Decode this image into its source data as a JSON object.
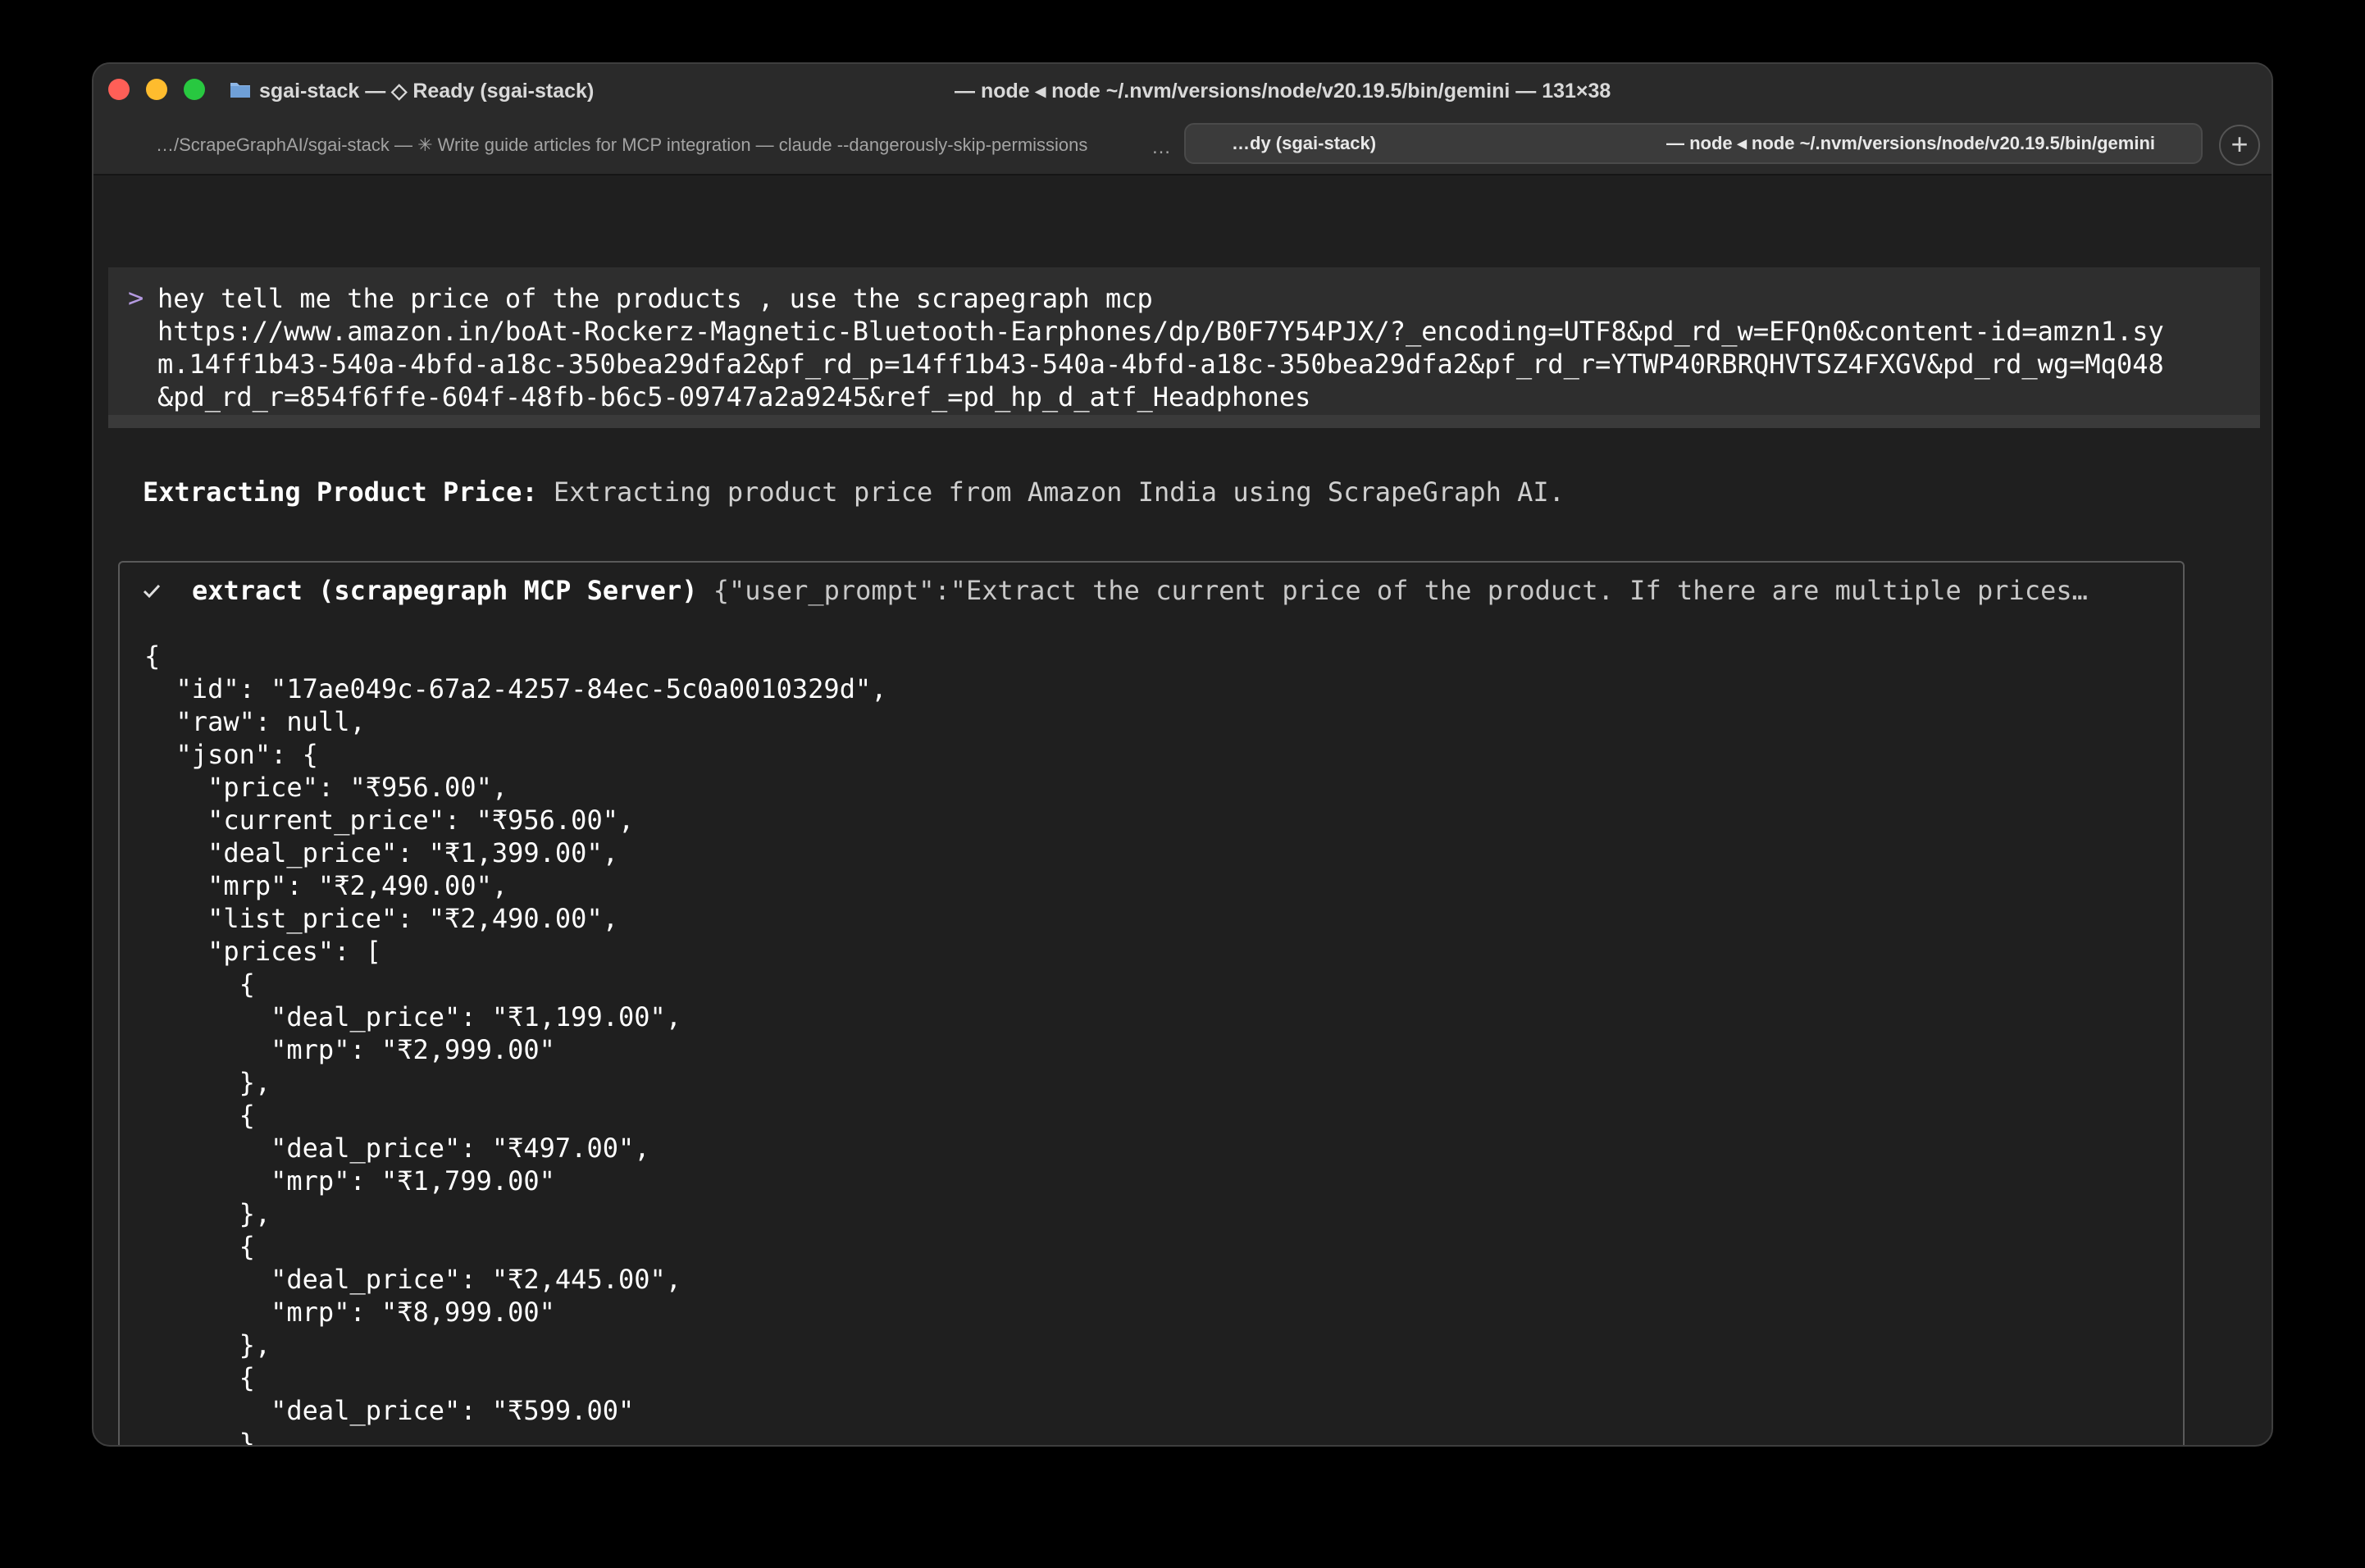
{
  "titlebar": {
    "left_title": "sgai-stack — ◇ Ready (sgai-stack)",
    "center_title": "— node ◂ node ~/.nvm/versions/node/v20.19.5/bin/gemini — 131×38"
  },
  "tabs": {
    "tab1_label": "…/ScrapeGraphAI/sgai-stack — ✳ Write guide articles for MCP integration — claude --dangerously-skip-permissions",
    "overflow_label": "…",
    "tab2_left": "…dy (sgai-stack)",
    "tab2_right": "— node ◂ node ~/.nvm/versions/node/v20.19.5/bin/gemini",
    "new_tab_label": "+"
  },
  "prompt": {
    "chevron": ">",
    "text": "hey tell me the price of the products , use the scrapegraph mcp\nhttps://www.amazon.in/boAt-Rockerz-Magnetic-Bluetooth-Earphones/dp/B0F7Y54PJX/?_encoding=UTF8&pd_rd_w=EFQn0&content-id=amzn1.sy\nm.14ff1b43-540a-4bfd-a18c-350bea29dfa2&pf_rd_p=14ff1b43-540a-4bfd-a18c-350bea29dfa2&pf_rd_r=YTWP40RBRQHVTSZ4FXGV&pd_rd_wg=Mq048\n&pd_rd_r=854f6ffe-604f-48fb-b6c5-09747a2a9245&ref_=pd_hp_d_atf_Headphones"
  },
  "status": {
    "label": "Extracting Product Price:",
    "text": " Extracting product price from Amazon India using ScrapeGraph AI."
  },
  "tool": {
    "name": "extract (scrapegraph MCP Server)",
    "args": " {\"user_prompt\":\"Extract the current price of the product. If there are multiple prices…",
    "output": "{\n  \"id\": \"17ae049c-67a2-4257-84ec-5c0a0010329d\",\n  \"raw\": null,\n  \"json\": {\n    \"price\": \"₹956.00\",\n    \"current_price\": \"₹956.00\",\n    \"deal_price\": \"₹1,399.00\",\n    \"mrp\": \"₹2,490.00\",\n    \"list_price\": \"₹2,490.00\",\n    \"prices\": [\n      {\n        \"deal_price\": \"₹1,199.00\",\n        \"mrp\": \"₹2,999.00\"\n      },\n      {\n        \"deal_price\": \"₹497.00\",\n        \"mrp\": \"₹1,799.00\"\n      },\n      {\n        \"deal_price\": \"₹2,445.00\",\n        \"mrp\": \"₹8,999.00\"\n      },\n      {\n        \"deal_price\": \"₹599.00\"\n      }\n    ],"
  },
  "colors": {
    "background": "#000000",
    "window": "#1f1f1f",
    "prompt_accent": "#b49ae0",
    "close": "#ff5f57",
    "minimize": "#febc2e",
    "maximize": "#28c840"
  }
}
